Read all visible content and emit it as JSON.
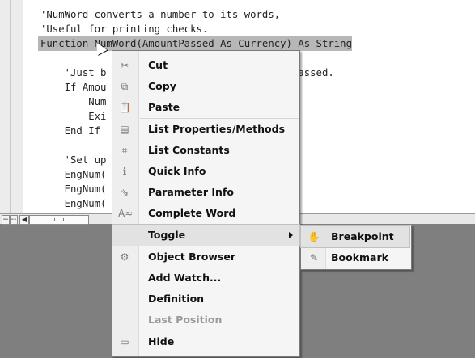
{
  "code_lines": [
    "'NumWord converts a number to its words,",
    "'Useful for printing checks.",
    "Function NumWord(AmountPassed As Currency) As String",
    "",
    "    'Just b                        amount passed.",
    "    If Amou",
    "        Num",
    "        Exi",
    "    End If",
    "",
    "    'Set up                       mbers.",
    "    EngNum(",
    "    EngNum(",
    "    EngNum("
  ],
  "context_menu": {
    "items": [
      {
        "label": "Cut",
        "icon": "scissors-icon",
        "glyph": "✂"
      },
      {
        "label": "Copy",
        "icon": "copy-icon",
        "glyph": "⧉"
      },
      {
        "label": "Paste",
        "icon": "paste-icon",
        "glyph": "📋"
      },
      {
        "label": "List Properties/Methods",
        "icon": "list-properties-icon",
        "glyph": "▤"
      },
      {
        "label": "List Constants",
        "icon": "list-constants-icon",
        "glyph": "⌗"
      },
      {
        "label": "Quick Info",
        "icon": "quick-info-icon",
        "glyph": "ℹ"
      },
      {
        "label": "Parameter Info",
        "icon": "parameter-info-icon",
        "glyph": "⇘"
      },
      {
        "label": "Complete Word",
        "icon": "complete-word-icon",
        "glyph": "A≈"
      },
      {
        "label": "Toggle",
        "icon": "",
        "glyph": ""
      },
      {
        "label": "Object Browser",
        "icon": "object-browser-icon",
        "glyph": "⚙"
      },
      {
        "label": "Add Watch...",
        "icon": "",
        "glyph": ""
      },
      {
        "label": "Definition",
        "icon": "",
        "glyph": ""
      },
      {
        "label": "Last Position",
        "icon": "",
        "glyph": ""
      },
      {
        "label": "Hide",
        "icon": "hide-icon",
        "glyph": "▭"
      }
    ],
    "disabled_item": "Last Position",
    "hot_item": "Toggle"
  },
  "submenu": {
    "items": [
      {
        "label": "Breakpoint",
        "icon": "hand-icon",
        "glyph": "✋"
      },
      {
        "label": "Bookmark",
        "icon": "bookmark-pen-icon",
        "glyph": "✎"
      }
    ]
  },
  "colors": {
    "selection": "#b7b7b7",
    "workspace": "#7f7f7f",
    "menu_bg": "#f5f5f5"
  }
}
